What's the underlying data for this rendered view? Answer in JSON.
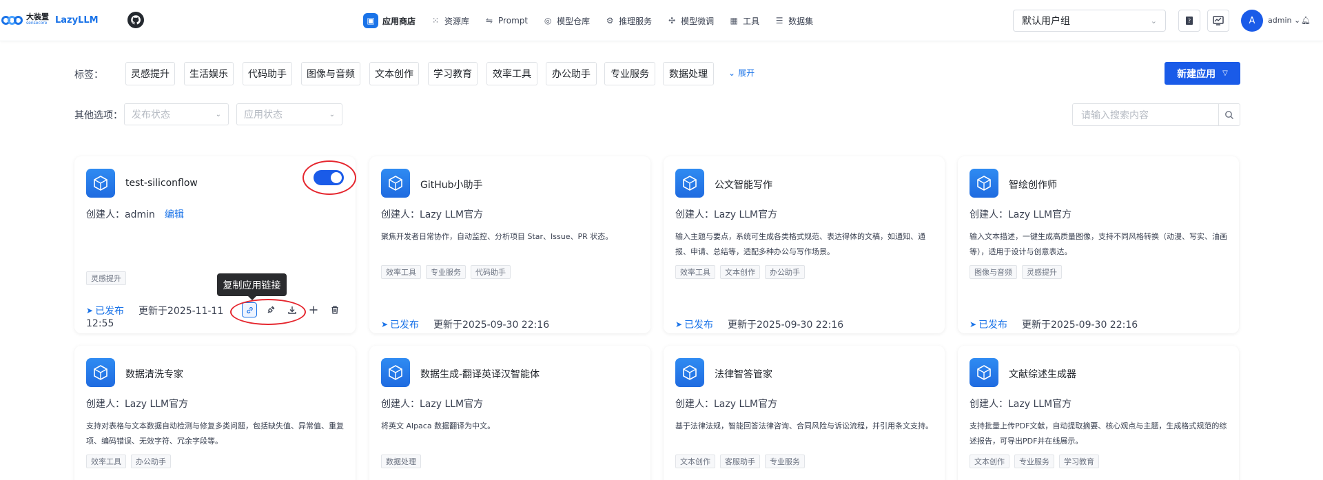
{
  "brand": {
    "cn": "大装置",
    "en": "sensecore",
    "product": "LazyLLM"
  },
  "nav": [
    {
      "label": "应用商店",
      "icon": "store-icon",
      "active": true
    },
    {
      "label": "资源库",
      "icon": "grid-icon"
    },
    {
      "label": "Prompt",
      "icon": "prompt-icon"
    },
    {
      "label": "模型仓库",
      "icon": "model-icon"
    },
    {
      "label": "推理服务",
      "icon": "inference-icon"
    },
    {
      "label": "模型微调",
      "icon": "finetune-icon"
    },
    {
      "label": "工具",
      "icon": "tools-icon"
    },
    {
      "label": "数据集",
      "icon": "dataset-icon"
    }
  ],
  "header": {
    "user_group": "默认用户组",
    "avatar_letter": "A",
    "username": "admin"
  },
  "filters": {
    "tags_label": "标签：",
    "tags": [
      "灵感提升",
      "生活娱乐",
      "代码助手",
      "图像与音频",
      "文本创作",
      "学习教育",
      "效率工具",
      "办公助手",
      "专业服务",
      "数据处理"
    ],
    "expand": "展开",
    "new_app": "新建应用",
    "other_label": "其他选项：",
    "publish_status": "发布状态",
    "app_status": "应用状态",
    "search_placeholder": "请输入搜索内容"
  },
  "tooltip": "复制应用链接",
  "cards": [
    {
      "title": "test-siliconflow",
      "creator": "创建人：admin",
      "edit": "编辑",
      "desc": "",
      "tags": [
        "灵感提升"
      ],
      "status": "已发布",
      "updated": "更新于2025-11-11",
      "updated2": "12:55"
    },
    {
      "title": "GitHub小助手",
      "creator": "创建人：Lazy LLM官方",
      "desc": "聚焦开发者日常协作，自动监控、分析项目 Star、Issue、PR 状态。",
      "tags": [
        "效率工具",
        "专业服务",
        "代码助手"
      ],
      "status": "已发布",
      "updated": "更新于2025-09-30 22:16"
    },
    {
      "title": "公文智能写作",
      "creator": "创建人：Lazy LLM官方",
      "desc": "输入主题与要点，系统可生成各类格式规范、表达得体的文稿，如通知、通报、申请、总结等，适配多种办公与写作场景。",
      "tags": [
        "效率工具",
        "文本创作",
        "办公助手"
      ],
      "status": "已发布",
      "updated": "更新于2025-09-30 22:16"
    },
    {
      "title": "智绘创作师",
      "creator": "创建人：Lazy LLM官方",
      "desc": "输入文本描述，一键生成高质量图像，支持不同风格转换（动漫、写实、油画等），适用于设计与创意表达。",
      "tags": [
        "图像与音频",
        "灵感提升"
      ],
      "status": "已发布",
      "updated": "更新于2025-09-30 22:16"
    },
    {
      "title": "数据清洗专家",
      "creator": "创建人：Lazy LLM官方",
      "desc": "支持对表格与文本数据自动检测与修复多类问题，包括缺失值、异常值、重复项、编码错误、无效字符、冗余字段等。",
      "tags": [
        "效率工具",
        "办公助手"
      ]
    },
    {
      "title": "数据生成-翻译英译汉智能体",
      "creator": "创建人：Lazy LLM官方",
      "desc": "将英文 Alpaca 数据翻译为中文。",
      "tags": [
        "数据处理"
      ]
    },
    {
      "title": "法律智答管家",
      "creator": "创建人：Lazy LLM官方",
      "desc": "基于法律法规，智能回答法律咨询、合同风险与诉讼流程，并引用条文支持。",
      "tags": [
        "文本创作",
        "客服助手",
        "专业服务"
      ]
    },
    {
      "title": "文献综述生成器",
      "creator": "创建人：Lazy LLM官方",
      "desc": "支持批量上传PDF文献，自动提取摘要、核心观点与主题，生成格式规范的综述报告，可导出PDF并在线展示。",
      "tags": [
        "文本创作",
        "专业服务",
        "学习教育"
      ]
    }
  ],
  "colors": {
    "accent": "#1a5be8",
    "link": "#1a73e8",
    "highlight_ring": "#e5262e"
  }
}
